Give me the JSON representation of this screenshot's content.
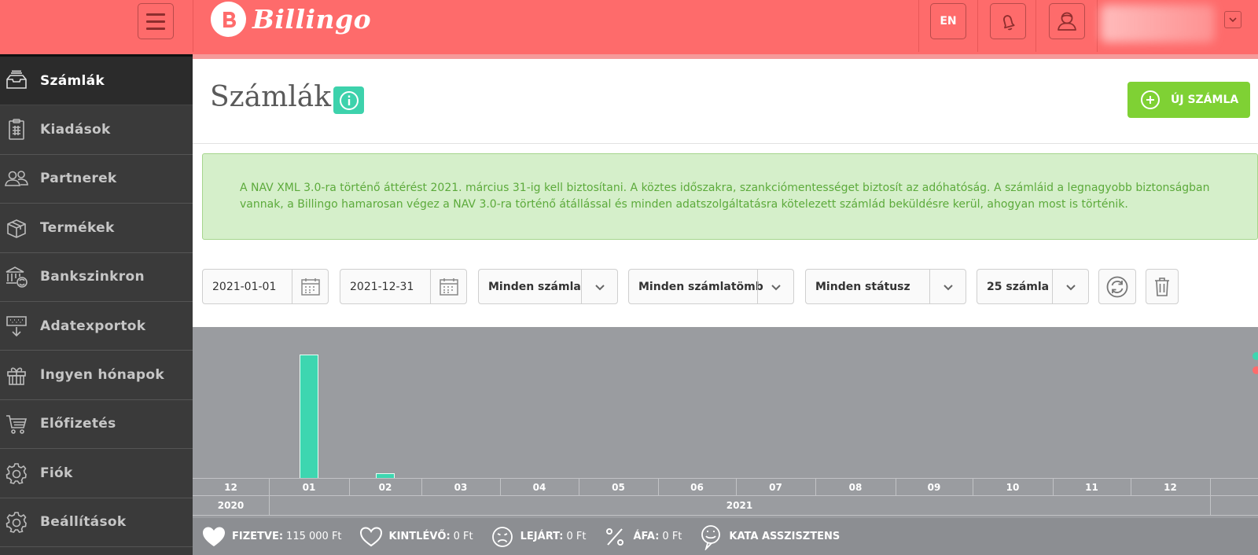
{
  "topbar": {
    "brand": "Billingo",
    "language": "EN",
    "colors": {
      "topbar": "#fe6b6b",
      "accent": "#3dd2ac",
      "primary_button": "#7fd134"
    }
  },
  "sidebar": {
    "items": [
      {
        "label": "Számlák",
        "icon": "invoices-icon",
        "active": true
      },
      {
        "label": "Kiadások",
        "icon": "expenses-icon"
      },
      {
        "label": "Partnerek",
        "icon": "partners-icon"
      },
      {
        "label": "Termékek",
        "icon": "products-icon"
      },
      {
        "label": "Bankszinkron",
        "icon": "bank-sync-icon"
      },
      {
        "label": "Adatexportok",
        "icon": "data-export-icon"
      },
      {
        "label": "Ingyen hónapok",
        "icon": "gift-icon"
      },
      {
        "label": "Előfizetés",
        "icon": "cart-icon"
      },
      {
        "label": "Fiók",
        "icon": "gear-icon"
      },
      {
        "label": "Beállítások",
        "icon": "gear-icon"
      }
    ]
  },
  "page": {
    "title": "Számlák",
    "new_button": "ÚJ SZÁMLA"
  },
  "notice": {
    "text": "A NAV XML 3.0-ra történő áttérést 2021. március 31-ig kell biztosítani. A köztes időszakra, szankciómentességet biztosít az adóhatóság. A számláid a legnagyobb biztonságban vannak, a Billingo hamarosan végez a NAV 3.0-ra történő átállással és minden adatszolgáltatásra kötelezett számlád beküldésre kerül, ahogyan most is történik."
  },
  "filters": {
    "date_from": "2021-01-01",
    "date_to": "2021-12-31",
    "invoice_type": "Minden számla",
    "invoice_block": "Minden számlatömb",
    "status": "Minden státusz",
    "page_size": "25 számla"
  },
  "chart_data": {
    "type": "bar",
    "categories": [
      "12",
      "01",
      "02",
      "03",
      "04",
      "05",
      "06",
      "07",
      "08",
      "09",
      "10",
      "11",
      "12"
    ],
    "years": [
      {
        "label": "2020",
        "months": [
          "12"
        ]
      },
      {
        "label": "2021",
        "months": [
          "01",
          "02",
          "03",
          "04",
          "05",
          "06",
          "07",
          "08",
          "09",
          "10",
          "11",
          "12"
        ]
      }
    ],
    "series": [
      {
        "values": [
          0,
          100,
          4,
          0,
          0,
          0,
          0,
          0,
          0,
          0,
          0,
          0,
          0
        ],
        "color": "#3dd6b0"
      }
    ],
    "legend_colors": [
      "#3dd6b0",
      "#fe6b6b"
    ],
    "ylim": [
      0,
      100
    ],
    "title": "",
    "xlabel": "",
    "ylabel": ""
  },
  "summary": [
    {
      "icon": "heart-filled-icon",
      "label": "FIZETVE:",
      "value": "115 000 Ft"
    },
    {
      "icon": "heart-outline-icon",
      "label": "KINTLÉVŐ:",
      "value": "0 Ft"
    },
    {
      "icon": "sad-face-icon",
      "label": "LEJÁRT:",
      "value": "0 Ft"
    },
    {
      "icon": "percent-icon",
      "label": "ÁFA:",
      "value": "0 Ft"
    },
    {
      "icon": "kata-assistant-icon",
      "label": "KATA ASSZISZTENS",
      "value": ""
    }
  ]
}
